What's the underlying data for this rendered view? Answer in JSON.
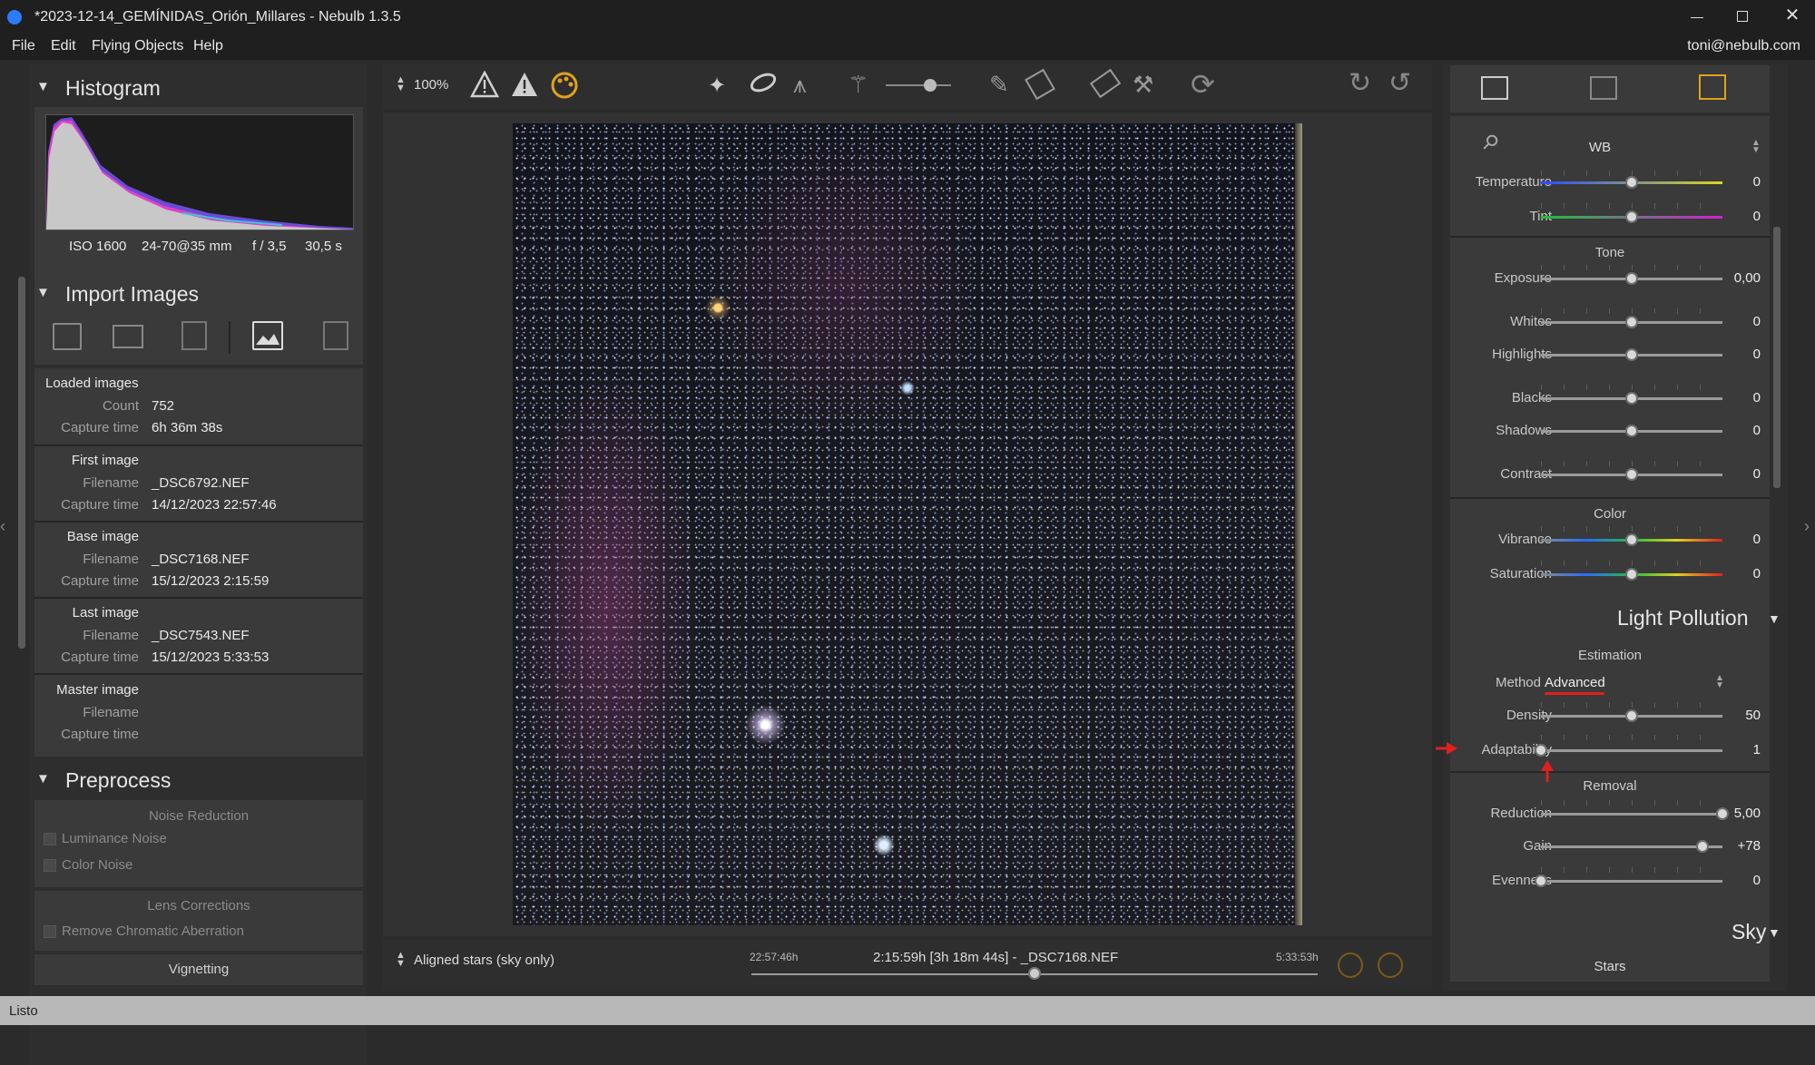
{
  "window": {
    "title": "*2023-12-14_GEMÍNIDAS_Orión_Millares - Nebulb 1.3.5",
    "account": "toni@nebulb.com"
  },
  "menu": [
    "File",
    "Edit",
    "Flying Objects",
    "Help"
  ],
  "histogram": {
    "title": "Histogram",
    "iso": "ISO 1600",
    "lens": "24-70@35 mm",
    "aperture": "f / 3,5",
    "exposure": "30,5 s"
  },
  "import": {
    "title": "Import Images",
    "loaded": {
      "heading": "Loaded images",
      "count_label": "Count",
      "count": "752",
      "capture_label": "Capture time",
      "capture": "6h 36m 38s"
    },
    "first": {
      "heading": "First image",
      "filename_label": "Filename",
      "filename": "_DSC6792.NEF",
      "capture_label": "Capture time",
      "capture": "14/12/2023 22:57:46"
    },
    "base": {
      "heading": "Base image",
      "filename_label": "Filename",
      "filename": "_DSC7168.NEF",
      "capture_label": "Capture time",
      "capture": "15/12/2023 2:15:59"
    },
    "last": {
      "heading": "Last image",
      "filename_label": "Filename",
      "filename": "_DSC7543.NEF",
      "capture_label": "Capture time",
      "capture": "15/12/2023 5:33:53"
    },
    "master": {
      "heading": "Master image",
      "filename_label": "Filename",
      "capture_label": "Capture time"
    }
  },
  "preprocess": {
    "title": "Preprocess",
    "noise_heading": "Noise Reduction",
    "luminance": "Luminance Noise",
    "color": "Color Noise",
    "lens_heading": "Lens Corrections",
    "chromatic": "Remove Chromatic Aberration",
    "vignetting": "Vignetting"
  },
  "toolbar": {
    "zoom": "100%"
  },
  "timeline": {
    "mode": "Aligned stars (sky only)",
    "start": "22:57:46h",
    "current": "2:15:59h [3h 18m 44s] - _DSC7168.NEF",
    "end": "5:33:53h",
    "position": 0.5
  },
  "develop": {
    "wb_label": "WB",
    "temperature": {
      "label": "Temperature",
      "value": "0",
      "pos": 0.5
    },
    "tint": {
      "label": "Tint",
      "value": "0",
      "pos": 0.5
    },
    "tone_heading": "Tone",
    "exposure": {
      "label": "Exposure",
      "value": "0,00",
      "pos": 0.5
    },
    "whites": {
      "label": "Whites",
      "value": "0",
      "pos": 0.5
    },
    "highlights": {
      "label": "Highlights",
      "value": "0",
      "pos": 0.5
    },
    "blacks": {
      "label": "Blacks",
      "value": "0",
      "pos": 0.5
    },
    "shadows": {
      "label": "Shadows",
      "value": "0",
      "pos": 0.5
    },
    "contrast": {
      "label": "Contrast",
      "value": "0",
      "pos": 0.5
    },
    "color_heading": "Color",
    "vibrance": {
      "label": "Vibrance",
      "value": "0",
      "pos": 0.5
    },
    "saturation": {
      "label": "Saturation",
      "value": "0",
      "pos": 0.5
    }
  },
  "light_pollution": {
    "title": "Light Pollution",
    "estimation": "Estimation",
    "method_label": "Method",
    "method": "Advanced",
    "density": {
      "label": "Density",
      "value": "50",
      "pos": 0.5
    },
    "adaptability": {
      "label": "Adaptability",
      "value": "1",
      "pos": 0.0
    },
    "removal": "Removal",
    "reduction": {
      "label": "Reduction",
      "value": "5,00",
      "pos": 1.0
    },
    "gain": {
      "label": "Gain",
      "value": "+78",
      "pos": 0.89
    },
    "evenness": {
      "label": "Evenness",
      "value": "0",
      "pos": 0.0
    }
  },
  "sky": {
    "title": "Sky",
    "stars": "Stars"
  },
  "status": "Listo",
  "colors": {
    "accent_orange": "#e0a21c",
    "annotation_red": "#e0201c"
  }
}
